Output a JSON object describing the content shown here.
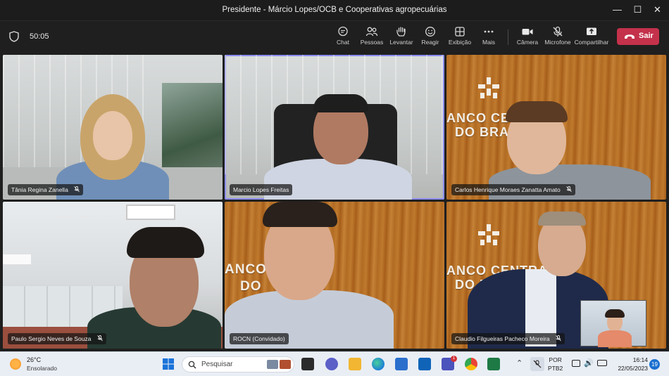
{
  "window": {
    "title": "Presidente - Márcio Lopes/OCB e Cooperativas agropecuárias",
    "minimize_glyph": "—",
    "maximize_glyph": "☐",
    "close_glyph": "✕"
  },
  "meeting": {
    "elapsed": "50:05",
    "toolbar": [
      {
        "id": "chat",
        "label": "Chat",
        "icon": "chat-icon"
      },
      {
        "id": "people",
        "label": "Pessoas",
        "icon": "people-icon"
      },
      {
        "id": "raise",
        "label": "Levantar",
        "icon": "hand-icon"
      },
      {
        "id": "react",
        "label": "Reagir",
        "icon": "smile-icon"
      },
      {
        "id": "view",
        "label": "Exibição",
        "icon": "grid-icon"
      },
      {
        "id": "more",
        "label": "Mais",
        "icon": "more-icon"
      },
      {
        "id": "camera",
        "label": "Câmera",
        "icon": "camera-icon"
      },
      {
        "id": "mic",
        "label": "Microfone",
        "icon": "mic-off-icon"
      },
      {
        "id": "share",
        "label": "Compartilhar",
        "icon": "share-icon"
      }
    ],
    "leave_label": "Sair",
    "leave_color": "#c4314b",
    "speaker_outline_color": "#8b8cf0"
  },
  "participants": [
    {
      "name": "Tânia Regina Zanella",
      "muted": true,
      "speaking": false
    },
    {
      "name": "Marcio Lopes Freitas",
      "muted": false,
      "speaking": true
    },
    {
      "name": "Carlos Henrique Moraes Zanatta Amato",
      "muted": true,
      "speaking": false
    },
    {
      "name": "Paulo Sergio Neves de Souza",
      "muted": true,
      "speaking": false
    },
    {
      "name": "ROCN (Convidado)",
      "muted": false,
      "speaking": false
    },
    {
      "name": "Claudio Filgueiras Pacheco Moreira",
      "muted": true,
      "speaking": false
    }
  ],
  "backgrounds": {
    "bcb_line1": "ANCO CENTRAL",
    "bcb_line2": "DO BRA",
    "bcb_line3": "ANCO CENTRAL",
    "bcb_line4": "DO BRASIL",
    "bcb_mid_line1": "ANCO   RAL",
    "bcb_mid_line2": "DO"
  },
  "taskbar": {
    "temperature": "26°C",
    "condition": "Ensolarado",
    "search_placeholder": "Pesquisar",
    "language_line1": "POR",
    "language_line2": "PTB2",
    "time": "16:14",
    "date": "22/05/2023",
    "notification_count": "19",
    "teams_badge": "1"
  }
}
